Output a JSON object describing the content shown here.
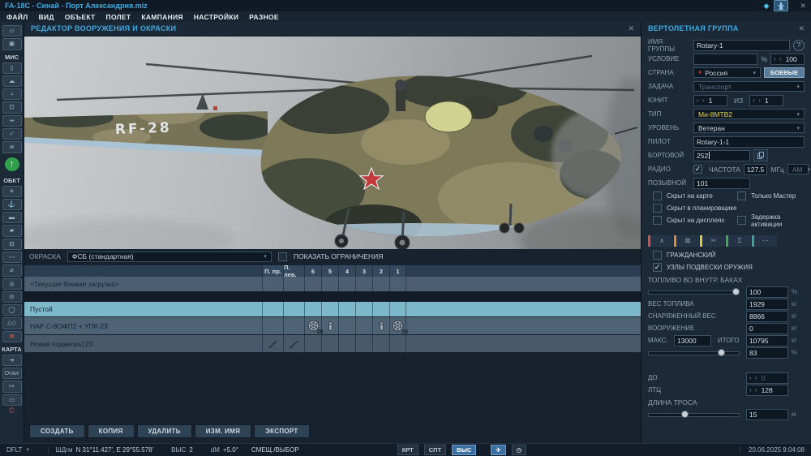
{
  "colors": {
    "accent": "#3fa9e0",
    "selected_row": "#7cb7ca",
    "type_highlight": "#e5d44a",
    "tab_colors": [
      "#d94f43",
      "#e0883c",
      "#ddc83e",
      "#47a856",
      "#3aa39b"
    ]
  },
  "titlebar": {
    "title": "FA-18C - Синай - Порт Александрия.miz",
    "gem_icon": "◆",
    "close_icon": "✕"
  },
  "menu": {
    "items": [
      "ФАЙЛ",
      "ВИД",
      "ОБЪЕКТ",
      "ПОЛЕТ",
      "КАМПАНИЯ",
      "НАСТРОЙКИ",
      "РАЗНОЕ"
    ]
  },
  "left_toolbar": {
    "section_mission": "МИС",
    "section_objects": "ОБКТ",
    "section_map": "КАРТА",
    "draw_label": "Draw",
    "items": [
      {
        "name": "new-file-icon",
        "glyph": "▱"
      },
      {
        "name": "save-icon",
        "glyph": "▣"
      },
      {
        "name": "briefing-icon",
        "glyph": "▯"
      },
      {
        "name": "weather-icon",
        "glyph": "☁"
      },
      {
        "name": "route-icon",
        "glyph": "≈"
      },
      {
        "name": "trigger-zone-icon",
        "glyph": "⊡"
      },
      {
        "name": "bullseye-icon",
        "glyph": "▪▪"
      },
      {
        "name": "goals-icon",
        "glyph": "✓"
      },
      {
        "name": "rules-chain-icon",
        "glyph": "≣"
      },
      {
        "name": "spawn-up-icon",
        "glyph": "↑"
      },
      {
        "name": "airplane-icon",
        "glyph": "✈"
      },
      {
        "name": "ship-icon",
        "glyph": "⚓"
      },
      {
        "name": "vehicle-icon",
        "glyph": "▬"
      },
      {
        "name": "tank-icon",
        "glyph": "▰"
      },
      {
        "name": "static-object-icon",
        "glyph": "⊟"
      },
      {
        "name": "group-icon",
        "glyph": "◦◦◦"
      },
      {
        "name": "rearm-point-icon",
        "glyph": "⌀"
      },
      {
        "name": "zone-icon",
        "glyph": "◎"
      },
      {
        "name": "restricted-icon",
        "glyph": "⊘"
      },
      {
        "name": "oval-template-icon",
        "glyph": "◯"
      },
      {
        "name": "shapes-icon",
        "glyph": "△◇"
      },
      {
        "name": "delete-icon",
        "glyph": "✖"
      },
      {
        "name": "measure-icon",
        "glyph": "➔"
      },
      {
        "name": "distance-icon",
        "glyph": "↦"
      },
      {
        "name": "rect-select-icon",
        "glyph": "▭"
      },
      {
        "name": "copyright-icon",
        "glyph": "©"
      }
    ]
  },
  "editor": {
    "title": "РЕДАКТОР ВООРУЖЕНИЯ И ОКРАСКИ",
    "close_icon": "✕",
    "marking": "RF-28",
    "paint_label": "ОКРАСКА",
    "paint_value": "ФСБ (стандартная)",
    "show_limits": "ПОКАЗАТЬ ОГРАНИЧЕНИЯ",
    "columns": [
      "П. пр.",
      "П. лев.",
      "6",
      "5",
      "4",
      "3",
      "2",
      "1"
    ],
    "loadouts": [
      {
        "name": "<Текущая боевая загрузка>"
      },
      {
        "name": "Пустой"
      },
      {
        "name": "НАР С-8ОФП2 + УПК-23",
        "stations": {
          "s6": {
            "icon": "rocket-pod-icon",
            "count": "20"
          },
          "s5": {
            "icon": "gun-pod-icon"
          },
          "s2": {
            "icon": "gun-pod-icon"
          },
          "s1": {
            "icon": "rocket-pod-icon",
            "count": "20"
          }
        }
      },
      {
        "name": "Новая подвеска123",
        "stations": {
          "right_outer": {
            "icon": "missile-icon"
          },
          "left_outer": {
            "icon": "missile-icon"
          }
        }
      }
    ],
    "buttons": [
      "СОЗДАТЬ",
      "КОПИЯ",
      "УДАЛИТЬ",
      "ИЗМ. ИМЯ",
      "ЭКСПОРТ"
    ]
  },
  "group_panel": {
    "title": "ВЕРТОЛЕТНАЯ ГРУППА",
    "close_icon": "✕",
    "name_label": "ИМЯ ГРУППЫ",
    "name_value": "Rotary-1",
    "help_glyph": "?",
    "cond_label": "УСЛОВИЕ",
    "cond_pct": "%",
    "cond_value": "100",
    "country_label": "СТРАНА",
    "country_value": "Россия",
    "combat_btn": "БОЕВЫЕ",
    "task_label": "ЗАДАЧА",
    "task_value": "Транспорт",
    "unit_label": "ЮНИТ",
    "unit_value": "1",
    "of_label": "ИЗ",
    "of_value": "1",
    "type_label": "ТИП",
    "type_value": "Ми-8МТВ2",
    "skill_label": "УРОВЕНЬ",
    "skill_value": "Ветеран",
    "pilot_label": "ПИЛОТ",
    "pilot_value": "Rotary-1-1",
    "board_label": "БОРТОВОЙ",
    "board_value": "252",
    "radio_label": "РАДИО",
    "freq_label": "ЧАСТОТА",
    "freq_value": "127.5",
    "freq_unit": "МГц",
    "mod_value": "АМ",
    "callsign_label": "ПОЗЫВНОЙ",
    "callsign_value": "101",
    "cb_hidden_map": "Скрыт на карте",
    "cb_master": "Только Мастер",
    "cb_hidden_planner": "Скрыт в планировщике",
    "cb_hidden_displays": "Скрыт на дисплеях",
    "cb_late": "Задержка активации",
    "tabs": [
      {
        "name": "route-tab",
        "glyph": "∧"
      },
      {
        "name": "payload-tab",
        "glyph": "⊠"
      },
      {
        "name": "edit-tab",
        "glyph": "✂"
      },
      {
        "name": "summary-tab",
        "glyph": "Σ"
      },
      {
        "name": "more-tab",
        "glyph": "⋯"
      }
    ],
    "cb_civilian": "ГРАЖДАНСКИЙ",
    "cb_pylons": "УЗЛЫ ПОДВЕСКИ ОРУЖИЯ",
    "fuel_label": "ТОПЛИВО ВО ВНУТР. БАКАХ",
    "fuel_value": "100",
    "pct": "%",
    "fuel_weight_label": "ВЕС ТОПЛИВА",
    "fuel_weight": "1929",
    "empty_weight_label": "СНАРЯЖЕННЫЙ ВЕС",
    "empty_weight": "8866",
    "weapon_weight_label": "ВООРУЖЕНИЕ",
    "weapon_weight": "0",
    "kg": "кг",
    "max_label": "МАКС.",
    "max_value": "13000",
    "total_label": "ИТОГО",
    "total_value": "10795",
    "load_pct": "83",
    "do_label": "ДО",
    "do_value": "0",
    "ltc_label": "ЛТЦ",
    "ltc_value": "128",
    "rope_label": "ДЛИНА ТРОСА",
    "rope_value": "15",
    "m": "м"
  },
  "status_bar": {
    "profile": "DFLT",
    "coord_format": "ШДгм",
    "coords": "N 31°11.427', E 29°55.578'",
    "alt_label": "ВЫС",
    "alt_value": "2",
    "dm_label": "dM",
    "dm_value": "+5.0°",
    "mode": "СМЕЩ./ВЫБОР",
    "btn_krt": "КРТ",
    "btn_spt": "СПТ",
    "btn_vys": "ВЫС",
    "datetime": "20.06.2025 9:04:08"
  }
}
